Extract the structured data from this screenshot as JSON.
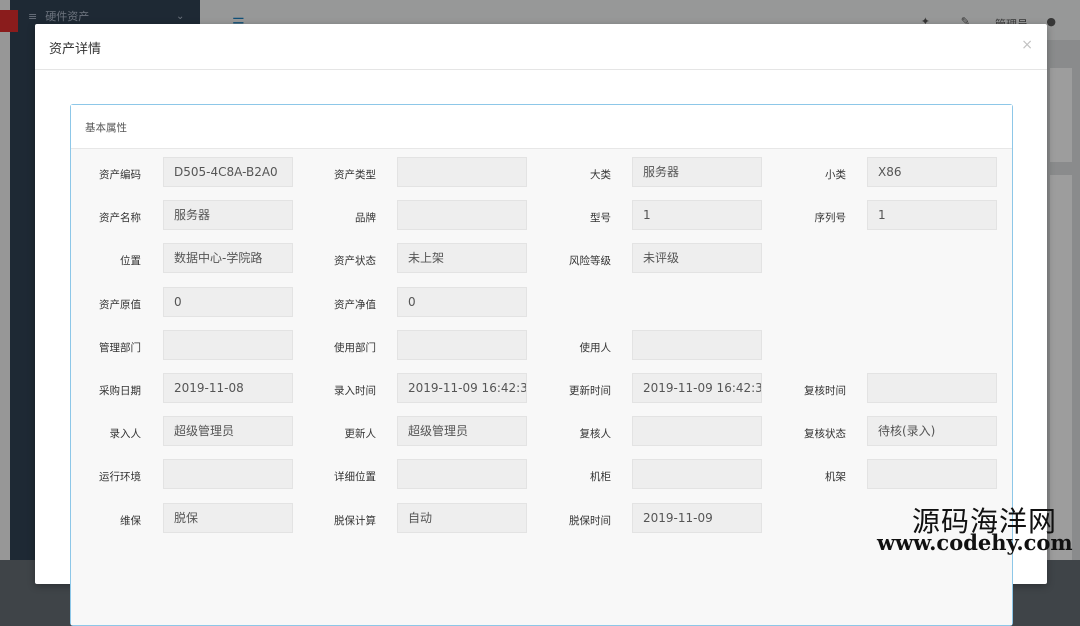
{
  "background": {
    "sidebar_menu": "硬件资产",
    "topbar_user": "管理员"
  },
  "modal": {
    "title": "资产详情",
    "close_symbol": "×"
  },
  "panel": {
    "title": "基本属性"
  },
  "rows": [
    [
      {
        "label": "资产编码",
        "value": "D505-4C8A-B2A0"
      },
      {
        "label": "资产类型",
        "value": ""
      },
      {
        "label": "大类",
        "value": "服务器"
      },
      {
        "label": "小类",
        "value": "X86"
      }
    ],
    [
      {
        "label": "资产名称",
        "value": "服务器"
      },
      {
        "label": "品牌",
        "value": ""
      },
      {
        "label": "型号",
        "value": "1"
      },
      {
        "label": "序列号",
        "value": "1"
      }
    ],
    [
      {
        "label": "位置",
        "value": "数据中心-学院路"
      },
      {
        "label": "资产状态",
        "value": "未上架"
      },
      {
        "label": "风险等级",
        "value": "未评级"
      }
    ],
    [
      {
        "label": "资产原值",
        "value": "0"
      },
      {
        "label": "资产净值",
        "value": "0"
      }
    ],
    [
      {
        "label": "管理部门",
        "value": ""
      },
      {
        "label": "使用部门",
        "value": ""
      },
      {
        "label": "使用人",
        "value": ""
      }
    ],
    [
      {
        "label": "采购日期",
        "value": "2019-11-08"
      },
      {
        "label": "录入时间",
        "value": "2019-11-09 16:42:3"
      },
      {
        "label": "更新时间",
        "value": "2019-11-09 16:42:3"
      },
      {
        "label": "复核时间",
        "value": ""
      }
    ],
    [
      {
        "label": "录入人",
        "value": "超级管理员"
      },
      {
        "label": "更新人",
        "value": "超级管理员"
      },
      {
        "label": "复核人",
        "value": ""
      },
      {
        "label": "复核状态",
        "value": "待核(录入)"
      }
    ],
    [
      {
        "label": "运行环境",
        "value": ""
      },
      {
        "label": "详细位置",
        "value": ""
      },
      {
        "label": "机柜",
        "value": ""
      },
      {
        "label": "机架",
        "value": ""
      }
    ],
    [
      {
        "label": "维保",
        "value": "脱保"
      },
      {
        "label": "脱保计算",
        "value": "自动"
      },
      {
        "label": "脱保时间",
        "value": "2019-11-09"
      }
    ]
  ],
  "watermark": {
    "cn": "源码海洋网",
    "en": "www.codehy.com"
  }
}
